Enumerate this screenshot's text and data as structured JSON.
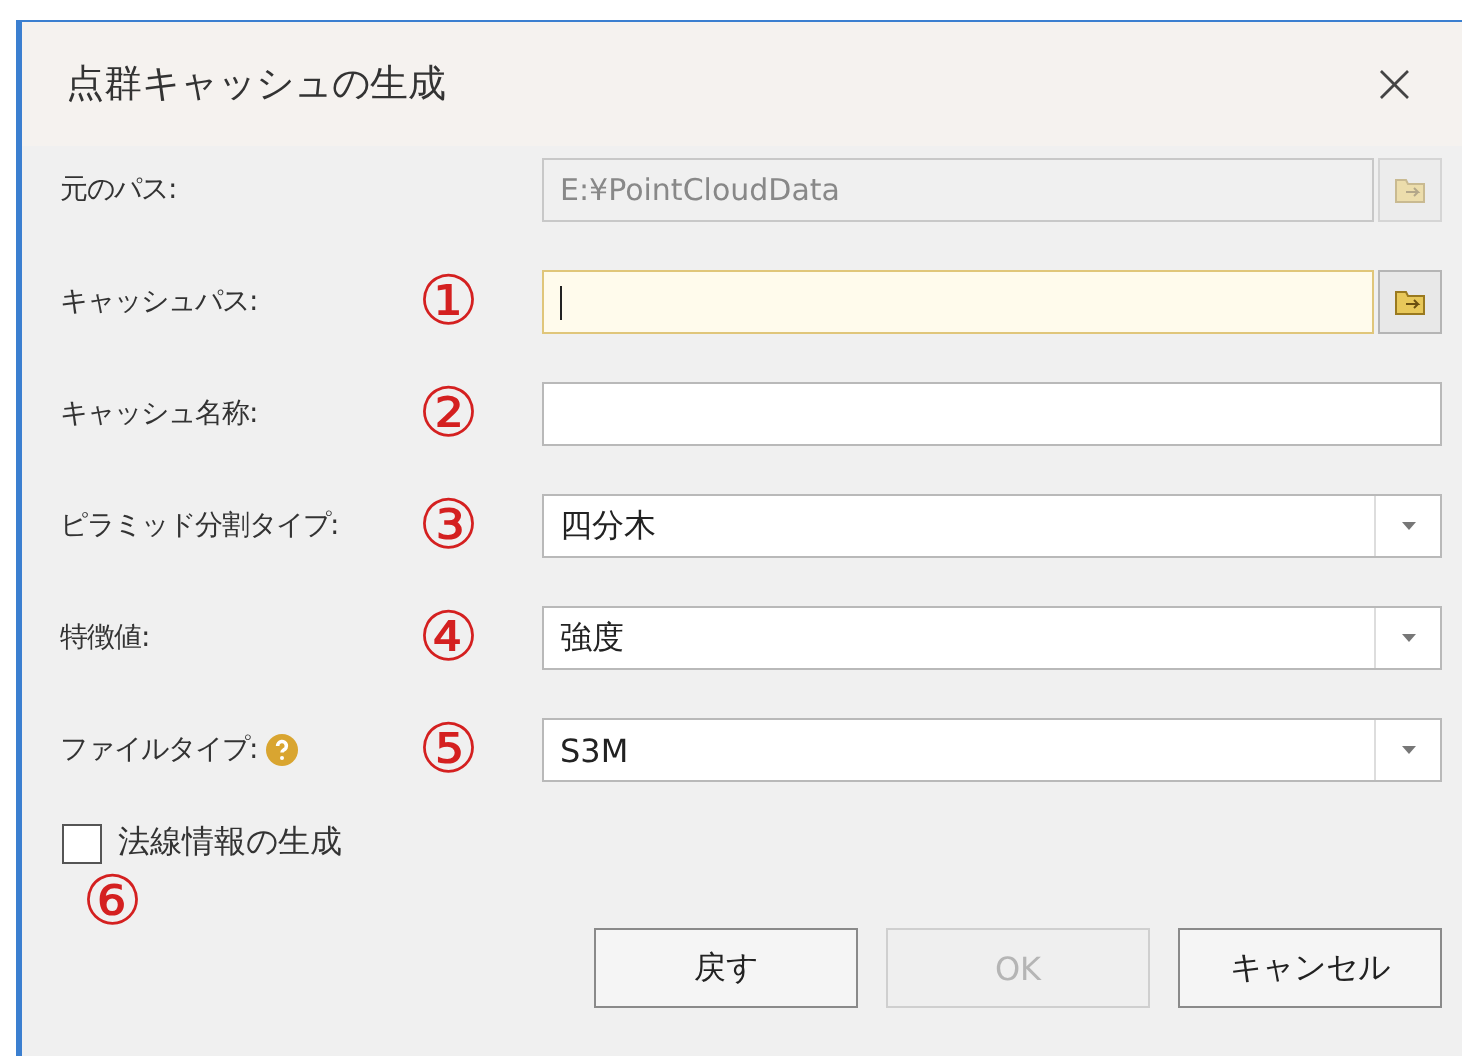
{
  "window": {
    "title": "点群キャッシュの生成",
    "close": "×"
  },
  "rows": [
    {
      "label": "元のパス:",
      "kind": "path",
      "value": "E:¥PointCloudData",
      "disabled": true
    },
    {
      "label": "キャッシュパス:",
      "marker": "①",
      "kind": "path",
      "disabled": false,
      "focused": true
    },
    {
      "label": "キャッシュ名称:",
      "marker": "②",
      "kind": "text",
      "disabled": false
    },
    {
      "label": "ピラミッド分割タイプ:",
      "marker": "③",
      "kind": "dropdown",
      "value": "四分木",
      "disabled": false
    },
    {
      "label": "特徴値:",
      "marker": "④",
      "kind": "dropdown",
      "value": "強度",
      "disabled": false
    },
    {
      "label": "ファイルタイプ:",
      "help": true,
      "marker": "⑤",
      "kind": "dropdown",
      "value": "S3M",
      "disabled": false
    }
  ],
  "checkbox": {
    "label": "法線情報の生成",
    "checked": false,
    "marker": "⑥"
  },
  "buttons": [
    {
      "label": "戻す",
      "disabled": false
    },
    {
      "label": "OK",
      "disabled": true
    },
    {
      "label": "キャンセル",
      "disabled": false
    }
  ]
}
